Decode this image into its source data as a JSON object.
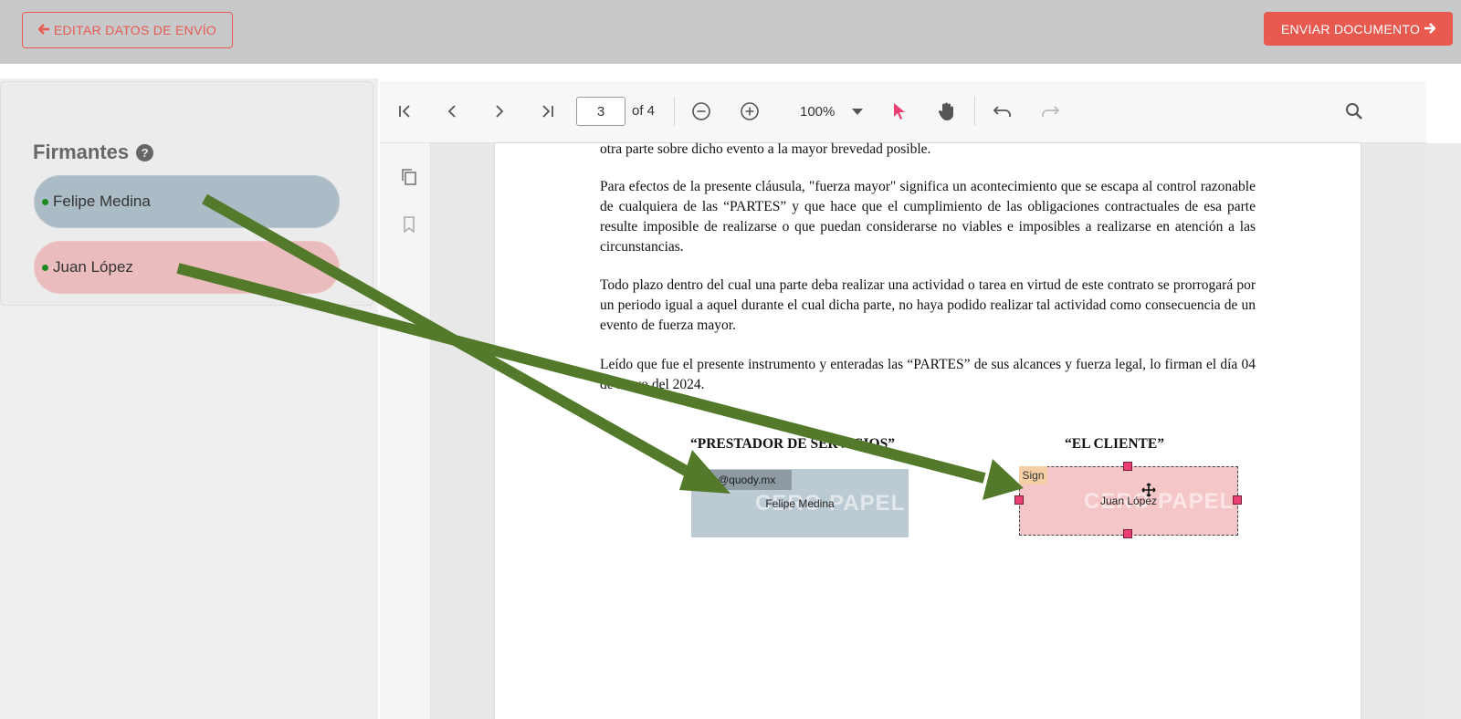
{
  "header": {
    "edit_button": "EDITAR DATOS DE ENVÍO",
    "send_button": "ENVIAR DOCUMENTO"
  },
  "signers": {
    "title": "Firmantes",
    "items": [
      {
        "name": "Felipe Medina"
      },
      {
        "name": "Juan López"
      }
    ]
  },
  "viewer": {
    "current_page": "3",
    "page_of": "of 4",
    "zoom": "100%"
  },
  "document": {
    "paragraphs": [
      "otra parte sobre dicho evento a la mayor brevedad posible.",
      "Para efectos de la presente cláusula, \"fuerza mayor\" significa un acontecimiento que se escapa al control razonable de cualquiera de las “PARTES” y que hace que el cumplimiento de las obligaciones contractuales de esa parte resulte imposible de realizarse o que puedan considerarse no viables e imposibles a realizarse en atención a las circunstancias.",
      "Todo plazo dentro del cual una parte deba realizar una actividad o tarea en virtud de este contrato se prorrogará por un periodo igual a aquel durante el cual dicha parte, no haya podido realizar tal actividad como consecuencia de un evento de fuerza mayor.",
      "Leído que fue el presente instrumento y enteradas las “PARTES” de sus alcances y fuerza legal, lo firman el día 04 de mayo del 2024."
    ],
    "sig_left_title": "“PRESTADOR DE SERVICIOS”",
    "sig_right_title": "“EL CLIENTE”"
  },
  "fields": {
    "left_email": "@quody.mx",
    "left_name": "Felipe Medina",
    "right_tag": "Sign",
    "right_name": "Juan López",
    "watermark": "CERO PAPEL"
  },
  "colors": {
    "accent": "#e85a50",
    "signer_blue": "#acbcc6",
    "signer_red": "#ebbcbd",
    "arrow": "#527a2a",
    "handle": "#ea3f72"
  },
  "icons": {
    "first_page": "first-page-icon",
    "prev_page": "chevron-left-icon",
    "next_page": "chevron-right-icon",
    "last_page": "last-page-icon",
    "zoom_out": "zoom-out-icon",
    "zoom_in": "zoom-in-icon",
    "select": "cursor-icon",
    "pan": "hand-icon",
    "undo": "undo-icon",
    "redo": "redo-icon",
    "search": "search-icon"
  }
}
